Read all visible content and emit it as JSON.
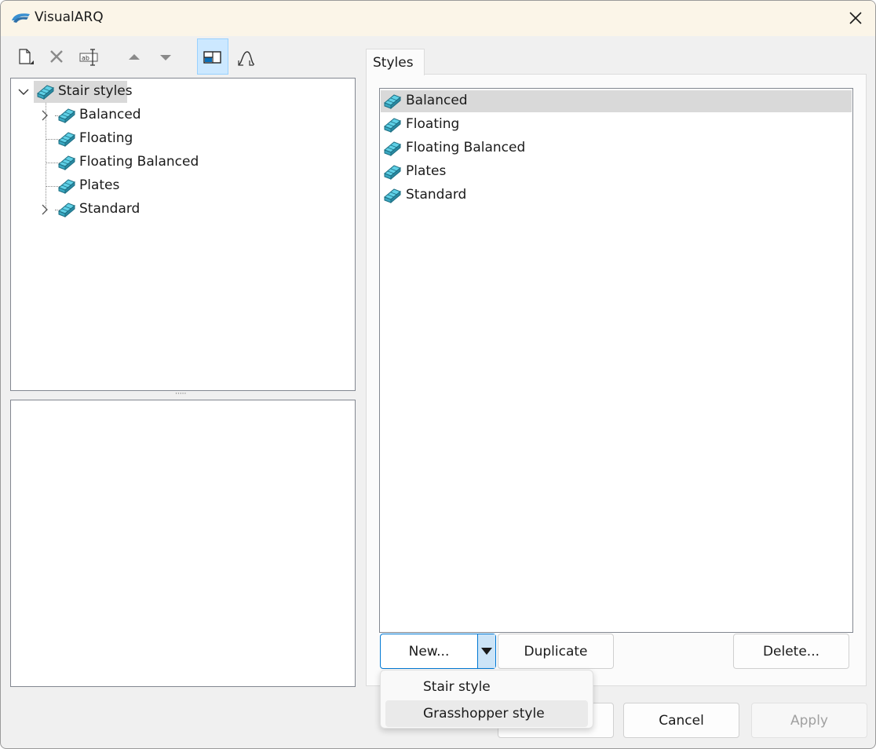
{
  "window": {
    "title": "VisualARQ",
    "close_icon": "close-icon"
  },
  "toolbar": {
    "buttons": [
      {
        "name": "new-document-button",
        "icon": "new-document-icon",
        "active": false
      },
      {
        "name": "delete-button",
        "icon": "delete-x-icon",
        "active": false
      },
      {
        "name": "rename-button",
        "icon": "rename-icon",
        "active": false
      },
      {
        "name": "move-up-button",
        "icon": "arrow-up-icon",
        "active": false
      },
      {
        "name": "move-down-button",
        "icon": "arrow-down-icon",
        "active": false
      },
      {
        "name": "layout-toggle-button",
        "icon": "panel-layout-icon",
        "active": true
      },
      {
        "name": "grasshopper-button",
        "icon": "grasshopper-icon",
        "active": false
      }
    ]
  },
  "tree": {
    "root": {
      "label": "Stair styles",
      "expanded": true,
      "selected": true
    },
    "items": [
      {
        "label": "Balanced",
        "has_children": true
      },
      {
        "label": "Floating",
        "has_children": false
      },
      {
        "label": "Floating Balanced",
        "has_children": false
      },
      {
        "label": "Plates",
        "has_children": false
      },
      {
        "label": "Standard",
        "has_children": true
      }
    ]
  },
  "tabs": [
    {
      "label": "Styles",
      "active": true
    }
  ],
  "styles_list": {
    "items": [
      {
        "label": "Balanced",
        "selected": true
      },
      {
        "label": "Floating",
        "selected": false
      },
      {
        "label": "Floating Balanced",
        "selected": false
      },
      {
        "label": "Plates",
        "selected": false
      },
      {
        "label": "Standard",
        "selected": false
      }
    ]
  },
  "buttons": {
    "new": "New...",
    "duplicate": "Duplicate",
    "delete": "Delete...",
    "cancel": "Cancel",
    "apply": "Apply"
  },
  "new_menu": {
    "items": [
      {
        "label": "Stair style",
        "hovered": false
      },
      {
        "label": "Grasshopper style",
        "hovered": true
      }
    ]
  },
  "colors": {
    "titlebar_bg": "#fbf5e8",
    "accent": "#0078d4",
    "selection_bg": "#d9d9d9",
    "icon_teal": "#4fc3d9"
  }
}
